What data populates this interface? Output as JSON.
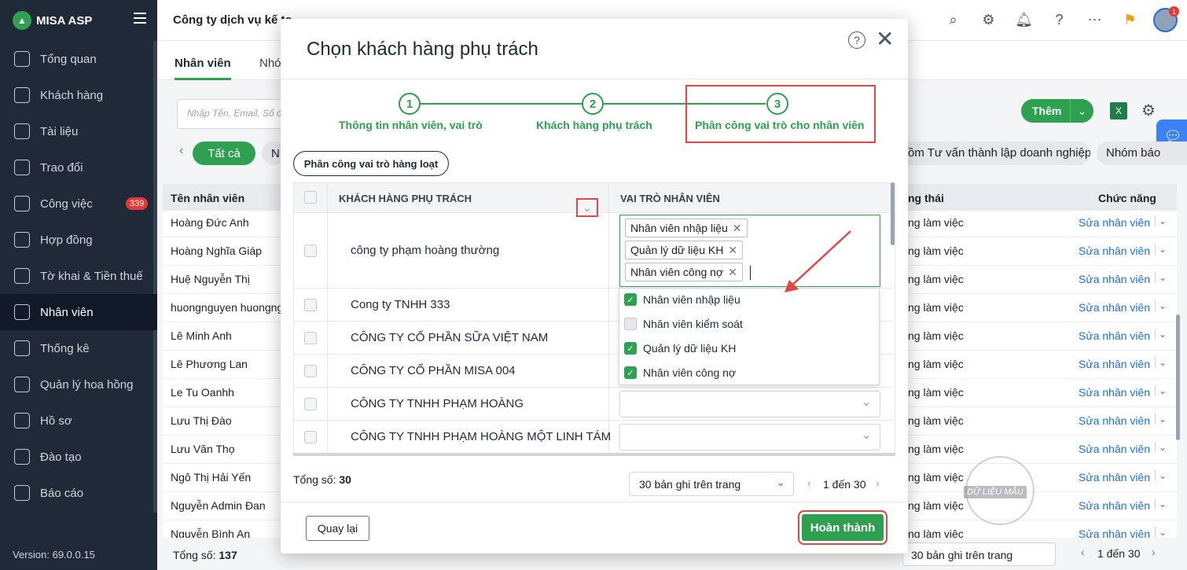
{
  "app": {
    "name": "MISA ASP",
    "version": "Version: 69.0.0.15",
    "company": "Công ty dịch vụ kế to"
  },
  "sidebar": {
    "items": [
      {
        "label": "Tổng quan",
        "icon": "dashboard-icon"
      },
      {
        "label": "Khách hàng",
        "icon": "user-icon"
      },
      {
        "label": "Tài liệu",
        "icon": "document-icon"
      },
      {
        "label": "Trao đổi",
        "icon": "chat-icon"
      },
      {
        "label": "Công việc",
        "icon": "task-icon",
        "badge": "339"
      },
      {
        "label": "Hợp đồng",
        "icon": "contract-icon"
      },
      {
        "label": "Tờ khai & Tiền thuế",
        "icon": "tax-icon"
      },
      {
        "label": "Nhân viên",
        "icon": "users-icon",
        "active": true
      },
      {
        "label": "Thống kê",
        "icon": "chart-icon"
      },
      {
        "label": "Quản lý hoa hồng",
        "icon": "commission-icon"
      },
      {
        "label": "Hồ sơ",
        "icon": "profile-icon"
      },
      {
        "label": "Đào tạo",
        "icon": "training-icon"
      },
      {
        "label": "Báo cáo",
        "icon": "report-icon"
      }
    ]
  },
  "topbar": {
    "notification_count": "1"
  },
  "tabs": {
    "active": "Nhân viên",
    "other": "Nhó"
  },
  "toolbar": {
    "search_placeholder": "Nhập Tên, Email, Số đ",
    "add_label": "Thêm",
    "add_caret": "⌄",
    "chip_all": "Tất cả",
    "chip_n": "N",
    "chip_group1": "ồm Tư vấn thành lập doanh nghiệp",
    "chip_group2": "Nhóm báo"
  },
  "bg_table": {
    "headers": {
      "name": "Tên nhân viên",
      "status": "ng thái",
      "action": "Chức năng"
    },
    "rows": [
      {
        "name": "Hoàng Đức Anh",
        "status": "ng làm việc",
        "action": "Sửa nhân viên"
      },
      {
        "name": "Hoàng Nghĩa Giáp",
        "status": "ng làm việc",
        "action": "Sửa nhân viên"
      },
      {
        "name": "Huệ Nguyễn Thị",
        "status": "ng làm việc",
        "action": "Sửa nhân viên"
      },
      {
        "name": "huongnguyen huongng",
        "status": "ng làm việc",
        "action": "Sửa nhân viên"
      },
      {
        "name": "Lê Minh Anh",
        "status": "ng làm việc",
        "action": "Sửa nhân viên"
      },
      {
        "name": "Lê Phương Lan",
        "status": "ng làm việc",
        "action": "Sửa nhân viên"
      },
      {
        "name": "Le Tu Oanhh",
        "status": "ng làm việc",
        "action": "Sửa nhân viên"
      },
      {
        "name": "Lưu Thị Đào",
        "status": "ng làm việc",
        "action": "Sửa nhân viên"
      },
      {
        "name": "Lưu Văn Thọ",
        "status": "ng làm việc",
        "action": "Sửa nhân viên"
      },
      {
        "name": "Ngô Thị Hải Yến",
        "status": "ng làm việc",
        "action": "Sửa nhân viên"
      },
      {
        "name": "Nguyễn Admin Đan",
        "status": "ng làm việc",
        "action": "Sửa nhân viên"
      },
      {
        "name": "Nguyễn Bình An",
        "status": "ng làm việc",
        "action": "Sửa nhân viên"
      }
    ],
    "total_label": "Tổng số:",
    "total": "137",
    "page_size": "30 bản ghi trên trang",
    "range": "1 đến 30",
    "stamp": "DỮ LIỆU MẪU"
  },
  "modal": {
    "title": "Chọn khách hàng phụ trách",
    "steps": [
      {
        "num": "1",
        "label": "Thông tin nhân viên, vai trò"
      },
      {
        "num": "2",
        "label": "Khách hàng phụ trách"
      },
      {
        "num": "3",
        "label": "Phân công vai trò cho nhân viên"
      }
    ],
    "bulk_label": "Phân công vai trò hàng loạt",
    "col_customer": "KHÁCH HÀNG PHỤ TRÁCH",
    "col_role": "VAI TRÒ NHÂN VIÊN",
    "rows": [
      {
        "name": "công ty phạm hoàng thường"
      },
      {
        "name": "Cong ty TNHH 333"
      },
      {
        "name": "CÔNG TY CỔ PHẦN SỮA VIỆT NAM"
      },
      {
        "name": "CÔNG TY CỔ PHẦN MISA 004"
      },
      {
        "name": "CÔNG TY TNHH PHẠM HOÀNG"
      },
      {
        "name": "CÔNG TY TNHH PHẠM HOÀNG MỘT LINH TÁM"
      }
    ],
    "tags": [
      "Nhân viên nhập liệu",
      "Quản lý dữ liệu KH",
      "Nhân viên công nợ"
    ],
    "options": [
      {
        "label": "Nhân viên nhập liệu",
        "checked": true
      },
      {
        "label": "Nhân viên kiểm soát",
        "checked": false
      },
      {
        "label": "Quản lý dữ liệu KH",
        "checked": true
      },
      {
        "label": "Nhân viên công nợ",
        "checked": true
      }
    ],
    "total_label": "Tổng số:",
    "total": "30",
    "page_size": "30 bản ghi trên trang",
    "range": "1 đến 30",
    "back_label": "Quay lại",
    "done_label": "Hoàn thành"
  },
  "colors": {
    "accent": "#2ea04f",
    "highlight": "#e04848",
    "sidebar": "#1f2937",
    "link": "#1e6fd9"
  }
}
